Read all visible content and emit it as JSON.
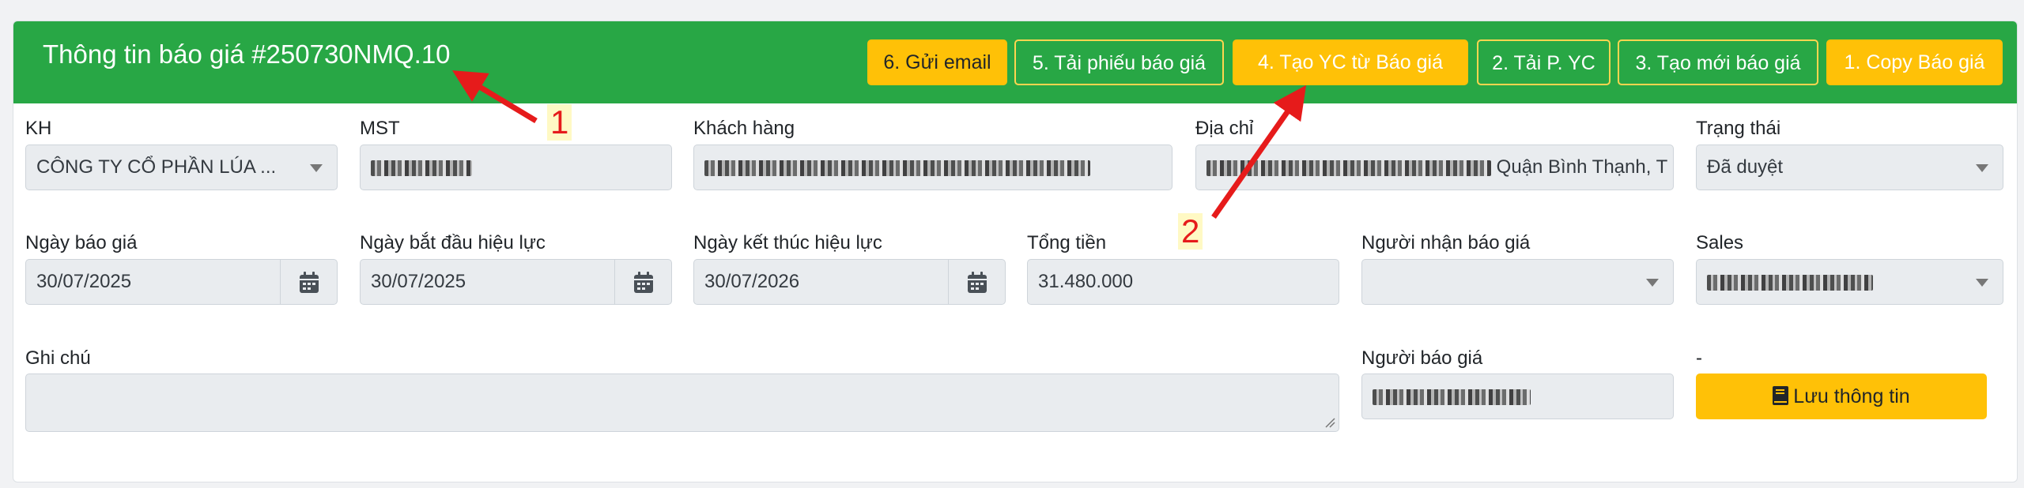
{
  "header": {
    "title": "Thông tin báo giá #250730NMQ.10",
    "buttons": [
      {
        "label": "6. Gửi email"
      },
      {
        "label": "5. Tải phiếu báo giá"
      },
      {
        "label": "4. Tạo YC từ Báo giá"
      },
      {
        "label": "2. Tải P. YC"
      },
      {
        "label": "3. Tạo mới báo giá"
      },
      {
        "label": "1. Copy Báo giá"
      }
    ]
  },
  "row1": {
    "kh": {
      "label": "KH",
      "value": "CÔNG TY CỔ PHẦN LÚA ..."
    },
    "mst": {
      "label": "MST"
    },
    "khach_hang": {
      "label": "Khách hàng"
    },
    "dia_chi": {
      "label": "Địa chỉ",
      "value_visible": "Quận Bình Thạnh, T"
    },
    "trang_thai": {
      "label": "Trạng thái",
      "value": "Đã duyệt"
    }
  },
  "row2": {
    "ngay_bao_gia": {
      "label": "Ngày báo giá",
      "value": "30/07/2025"
    },
    "ngay_bat_dau": {
      "label": "Ngày bắt đầu hiệu lực",
      "value": "30/07/2025"
    },
    "ngay_ket_thuc": {
      "label": "Ngày kết thúc hiệu lực",
      "value": "30/07/2026"
    },
    "tong_tien": {
      "label": "Tổng tiền",
      "value": "31.480.000"
    },
    "nguoi_nhan": {
      "label": "Người nhận báo giá",
      "value": ""
    },
    "sales": {
      "label": "Sales"
    }
  },
  "row3": {
    "ghi_chu": {
      "label": "Ghi chú",
      "value": ""
    },
    "nguoi_bao_gia": {
      "label": "Người báo giá"
    },
    "dash": {
      "label": "-"
    },
    "save_label": "Lưu thông tin"
  },
  "annotations": {
    "one": "1",
    "two": "2"
  },
  "colors": {
    "header_green": "#28a745",
    "button_yellow": "#ffc107",
    "annotation_red": "#e61b1b"
  },
  "icons": {
    "calendar": "calendar-icon",
    "caret": "chevron-down-icon",
    "book": "book-icon"
  }
}
